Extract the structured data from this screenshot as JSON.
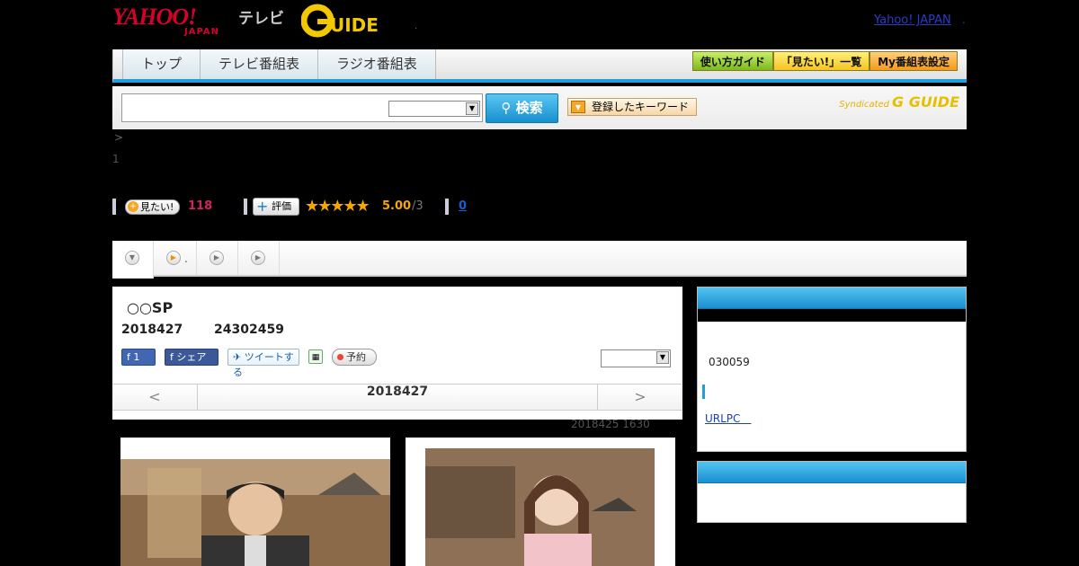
{
  "header": {
    "yahoo_logo": "YAHOO!",
    "yahoo_logo_sub": "JAPAN",
    "tv_label": "テレビ",
    "gguide_logo": "G GUIDE",
    "yahoo_japan_link": "Yahoo! JAPAN",
    "sep1": ".",
    "sep2": "."
  },
  "nav": {
    "tabs": [
      {
        "label": "トップ"
      },
      {
        "label": "テレビ番組表"
      },
      {
        "label": "ラジオ番組表"
      }
    ],
    "guide_button": "使い方ガイド",
    "mitai_list_button": "「見たい!」一覧",
    "my_settings_button": "My番組表設定"
  },
  "search": {
    "input_value": "",
    "button_label": "検索",
    "registered_keyword_button": "登録したキーワード",
    "syndicated_label": "Syndicated",
    "syndicated_logo": "G GUIDE"
  },
  "breadcrumb": ">",
  "count_line": "1",
  "rating": {
    "mitai_label": "見たい!",
    "mitai_count": "118",
    "hyoka_label": "評価",
    "stars": "★★★★★",
    "score": "5.00",
    "score_denominator": "/3",
    "comments_link": "0"
  },
  "segment_tabs": {
    "second_tab_suffix": "."
  },
  "program": {
    "title": "○○SP",
    "date": "2018427",
    "time": "24302459",
    "like_count": "1",
    "share_label": "シェア",
    "tweet_label": "ツイートする",
    "reserve_label": "予約",
    "date_nav_prev": "<",
    "date_nav_current": "2018427",
    "date_nav_next": ">",
    "updated": "2018425  1630"
  },
  "sidebar": {
    "box1_text": "030059",
    "box1_link": "URLPC　"
  },
  "colors": {
    "accent_blue": "#1ea0e0",
    "rating_orange": "#f5a600",
    "mitai_pink": "#d1245b"
  }
}
